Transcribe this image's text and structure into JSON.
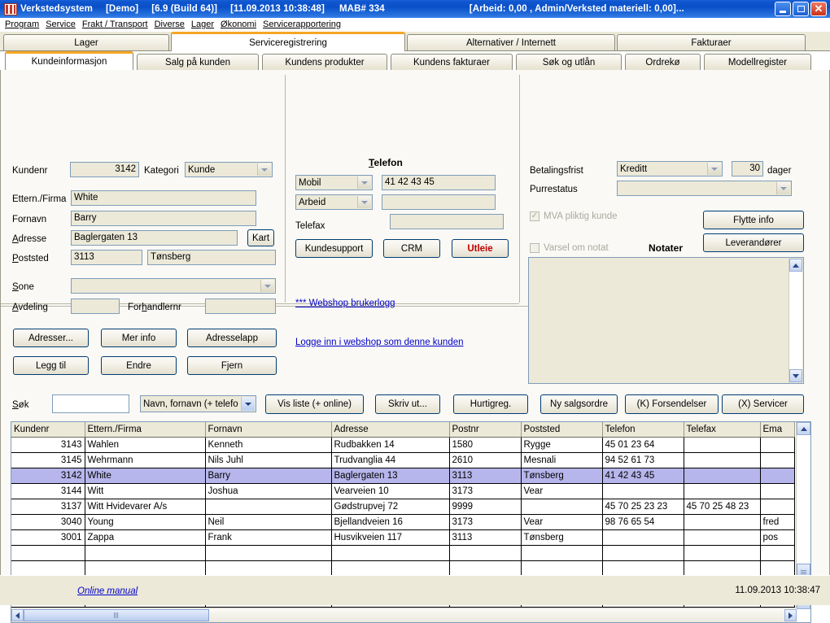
{
  "window": {
    "app_title": "Verkstedsystem",
    "demo_tag": "[Demo]",
    "version": "[6.9 (Build 64)]",
    "datetime": "[11.09.2013   10:38:48]",
    "mab": "MAB# 334",
    "totals": "[Arbeid: 0,00 , Admin/Verksted materiell: 0,00]...",
    "icon": "app-icon",
    "minimize": "minimize-icon",
    "maximize": "maximize-icon",
    "close": "close-icon"
  },
  "menubar": {
    "items": [
      {
        "label": "Program"
      },
      {
        "label": "Service"
      },
      {
        "label": "Frakt / Transport"
      },
      {
        "label": "Diverse"
      },
      {
        "label": "Lager"
      },
      {
        "label": "Økonomi"
      },
      {
        "label": "Servicerapportering"
      }
    ]
  },
  "main_tabs": [
    {
      "label": "Lager",
      "active": false
    },
    {
      "label": "Serviceregistrering",
      "active": true
    },
    {
      "label": "Alternativer / Internett",
      "active": false
    },
    {
      "label": "Fakturaer",
      "active": false
    }
  ],
  "sub_tabs": [
    {
      "label": "Kundeinformasjon",
      "active": true
    },
    {
      "label": "Salg på kunden",
      "active": false
    },
    {
      "label": "Kundens produkter",
      "active": false
    },
    {
      "label": "Kundens fakturaer",
      "active": false
    },
    {
      "label": "Søk og utlån",
      "active": false
    },
    {
      "label": "Ordrekø",
      "active": false
    },
    {
      "label": "Modellregister",
      "active": false
    }
  ],
  "customer": {
    "kundenr_label": "Kundenr",
    "kundenr_value": "3142",
    "kategori_label": "Kategori",
    "kategori_value": "Kunde",
    "etternavn_label": "Ettern./Firma",
    "etternavn_value": "White",
    "fornavn_label": "Fornavn",
    "fornavn_value": "Barry",
    "adresse_label": "Adresse",
    "adresse_value": "Baglergaten 13",
    "kart_button": "Kart",
    "poststed_label": "Poststed",
    "postnr_value": "3113",
    "poststed_value": "Tønsberg",
    "sone_label": "Sone",
    "sone_value": "",
    "avdeling_label": "Avdeling",
    "avdeling_value": "",
    "forhandlernr_label": "Forhandlernr",
    "forhandlernr_value": "",
    "buttons": [
      {
        "label": "Adresser..."
      },
      {
        "label": "Mer info"
      },
      {
        "label": "Adresselapp"
      },
      {
        "label": "Legg til"
      },
      {
        "label": "Endre"
      },
      {
        "label": "Fjern"
      }
    ]
  },
  "telefon": {
    "title": "Telefon",
    "type1": "Mobil",
    "number1": "41 42 43 45",
    "type2": "Arbeid",
    "number2": "",
    "telefax_label": "Telefax",
    "telefax_value": "",
    "buttons": [
      {
        "label": "Kundesupport",
        "style": "normal"
      },
      {
        "label": "CRM",
        "style": "normal"
      },
      {
        "label": "Utleie",
        "style": "red"
      }
    ],
    "link_webshop_log": "*** Webshop brukerlogg",
    "link_webshop_login": "Logge inn i webshop som denne kunden"
  },
  "payment": {
    "betalingsfrist_label": "Betalingsfrist",
    "betalingsfrist_value": "Kreditt",
    "dager_value": "30",
    "dager_label": "dager",
    "purrestatus_label": "Purrestatus",
    "purrestatus_value": "",
    "mva_label": "MVA pliktig kunde",
    "mva_checked": true,
    "varsel_label": "Varsel om notat",
    "varsel_checked": false,
    "notater_label": "Notater",
    "notater_value": "",
    "flytte_info_button": "Flytte info",
    "leverandorer_button": "Leverandører"
  },
  "searchbar": {
    "sok_label": "Søk",
    "sok_value": "",
    "sort_value": "Navn, fornavn (+ telefo",
    "buttons": [
      {
        "label": "Vis liste (+ online)"
      },
      {
        "label": "Skriv ut..."
      },
      {
        "label": "Hurtigreg."
      },
      {
        "label": "Ny salgsordre"
      },
      {
        "label": "(K) Forsendelser"
      },
      {
        "label": "(X) Servicer"
      }
    ]
  },
  "grid": {
    "columns": [
      "Kundenr",
      "Ettern./Firma",
      "Fornavn",
      "Adresse",
      "Postnr",
      "Poststed",
      "Telefon",
      "Telefax",
      "Ema"
    ],
    "rows": [
      {
        "kundenr": "3143",
        "etternavn": "Wahlen",
        "fornavn": "Kenneth",
        "adresse": "Rudbakken 14",
        "postnr": "1580",
        "poststed": "Rygge",
        "telefon": "45 01 23 64",
        "telefax": "",
        "email": "",
        "selected": false
      },
      {
        "kundenr": "3145",
        "etternavn": "Wehrmann",
        "fornavn": "Nils Juhl",
        "adresse": "Trudvanglia 44",
        "postnr": "2610",
        "poststed": "Mesnali",
        "telefon": "94 52 61 73",
        "telefax": "",
        "email": "",
        "selected": false
      },
      {
        "kundenr": "3142",
        "etternavn": "White",
        "fornavn": "Barry",
        "adresse": "Baglergaten 13",
        "postnr": "3113",
        "poststed": "Tønsberg",
        "telefon": "41 42 43 45",
        "telefax": "",
        "email": "",
        "selected": true
      },
      {
        "kundenr": "3144",
        "etternavn": "Witt",
        "fornavn": "Joshua",
        "adresse": "Vearveien 10",
        "postnr": "3173",
        "poststed": "Vear",
        "telefon": "",
        "telefax": "",
        "email": "",
        "selected": false
      },
      {
        "kundenr": "3137",
        "etternavn": "Witt Hvidevarer A/s",
        "fornavn": "",
        "adresse": "Gødstrupvej 72",
        "postnr": "9999",
        "poststed": "",
        "telefon": "45 70 25 23 23",
        "telefax": "45 70 25 48 23",
        "email": "",
        "selected": false
      },
      {
        "kundenr": "3040",
        "etternavn": "Young",
        "fornavn": "Neil",
        "adresse": "Bjellandveien 16",
        "postnr": "3173",
        "poststed": "Vear",
        "telefon": "98 76 65 54",
        "telefax": "",
        "email": "fred",
        "selected": false
      },
      {
        "kundenr": "3001",
        "etternavn": "Zappa",
        "fornavn": "Frank",
        "adresse": "Husvikveien 117",
        "postnr": "3113",
        "poststed": "Tønsberg",
        "telefon": "",
        "telefax": "",
        "email": "pos",
        "selected": false
      },
      {
        "kundenr": "",
        "etternavn": "",
        "fornavn": "",
        "adresse": "",
        "postnr": "",
        "poststed": "",
        "telefon": "",
        "telefax": "",
        "email": "",
        "selected": false
      },
      {
        "kundenr": "",
        "etternavn": "",
        "fornavn": "",
        "adresse": "",
        "postnr": "",
        "poststed": "",
        "telefon": "",
        "telefax": "",
        "email": "",
        "selected": false
      },
      {
        "kundenr": "",
        "etternavn": "",
        "fornavn": "",
        "adresse": "",
        "postnr": "",
        "poststed": "",
        "telefon": "",
        "telefax": "",
        "email": "",
        "selected": false
      },
      {
        "kundenr": "",
        "etternavn": "",
        "fornavn": "",
        "adresse": "",
        "postnr": "",
        "poststed": "",
        "telefon": "",
        "telefax": "",
        "email": "",
        "selected": false
      },
      {
        "kundenr": "",
        "etternavn": "",
        "fornavn": "",
        "adresse": "",
        "postnr": "",
        "poststed": "",
        "telefon": "",
        "telefax": "",
        "email": "",
        "selected": false
      }
    ]
  },
  "statusbar": {
    "online_manual": "Online manual",
    "datetime": "11.09.2013  10:38:47"
  },
  "colors": {
    "title_blue": "#0a51c8",
    "accent_orange": "#f5a623",
    "selection": "#b6b6ec",
    "client_bg": "#ece9d8",
    "field_bg": "#ece9d8",
    "link": "#0000c8",
    "red_button_text": "#c00000"
  }
}
